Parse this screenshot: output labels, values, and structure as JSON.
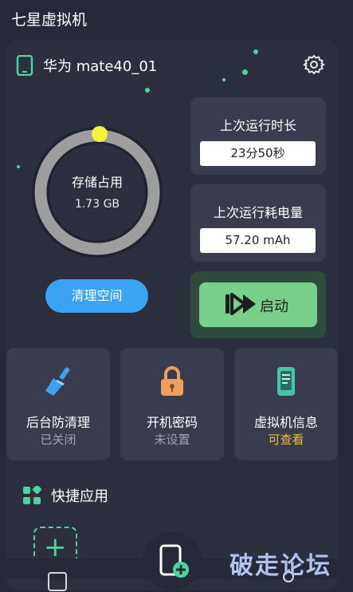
{
  "app": {
    "title": "七星虚拟机"
  },
  "device": {
    "name": "华为 mate40_01",
    "icon": "phone-icon",
    "settings_icon": "gear-icon"
  },
  "storage": {
    "label": "存储占用",
    "value": "1.73 GB",
    "button": "清理空间",
    "ring_color": "#9e9e9e",
    "knob_color": "#f2f23a"
  },
  "stats": [
    {
      "label": "上次运行时长",
      "value": "23分50秒"
    },
    {
      "label": "上次运行耗电量",
      "value": "57.20 mAh"
    }
  ],
  "start": {
    "label": "启动",
    "icon": "play-icon"
  },
  "features": [
    {
      "title": "后台防清理",
      "status": "已关闭",
      "icon": "broom-icon"
    },
    {
      "title": "开机密码",
      "status": "未设置",
      "icon": "lock-icon"
    },
    {
      "title": "虚拟机信息",
      "status": "可查看",
      "icon": "device-info-icon"
    }
  ],
  "quick": {
    "title": "快捷应用",
    "add_symbol": "+",
    "icon": "apps-grid-icon"
  },
  "watermark": "破走论坛",
  "colors": {
    "accent_green": "#4fd39c",
    "accent_blue": "#3aa3f3",
    "start_green": "#78d08a",
    "status_highlight": "#f0c030"
  }
}
